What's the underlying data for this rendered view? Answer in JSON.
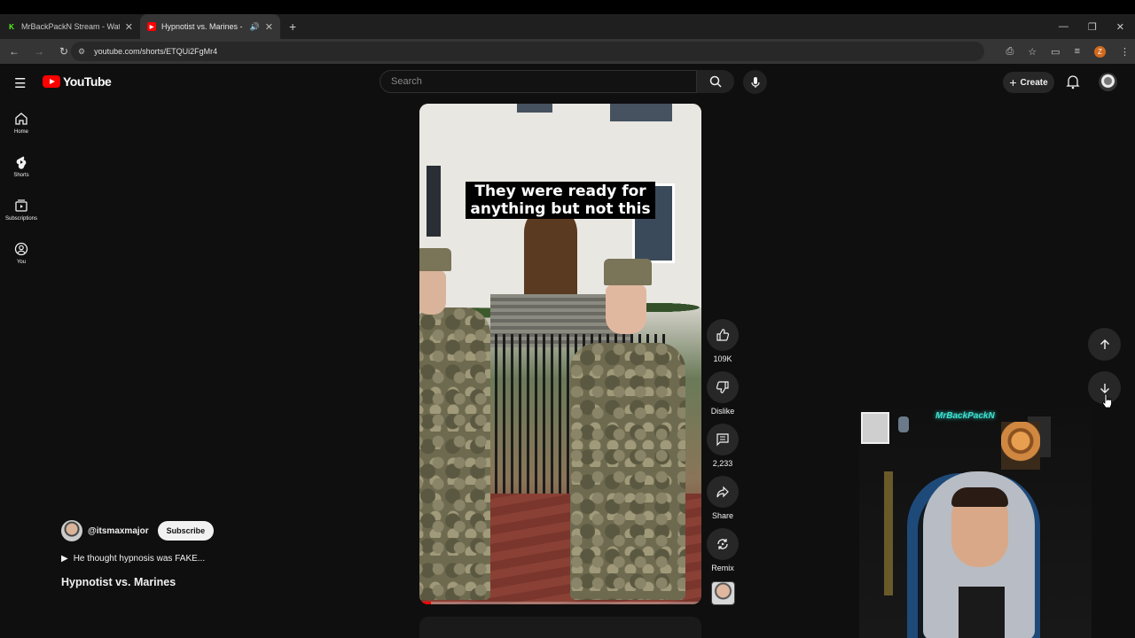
{
  "browser": {
    "tabs": [
      {
        "title": "MrBackPackN Stream - Watch l",
        "favicon": "K",
        "favicon_color": "#53fc18",
        "active": false
      },
      {
        "title": "Hypnotist vs. Marines - You",
        "favicon": "▶",
        "favicon_color": "#ff0000",
        "active": true
      }
    ],
    "url": "youtube.com/shorts/ETQUi2FgMr4",
    "profile_initial": "Z"
  },
  "masthead": {
    "logo_text": "YouTube",
    "search_placeholder": "Search",
    "create_label": "Create"
  },
  "guide": {
    "items": [
      {
        "label": "Home",
        "icon": "home-icon"
      },
      {
        "label": "Shorts",
        "icon": "shorts-icon"
      },
      {
        "label": "Subscriptions",
        "icon": "subscriptions-icon"
      },
      {
        "label": "You",
        "icon": "you-icon"
      }
    ]
  },
  "video": {
    "caption_line1": "They were ready for",
    "caption_line2": "anything but not this",
    "progress": 0.04
  },
  "actions": {
    "like_count": "109K",
    "dislike_label": "Dislike",
    "comment_count": "2,233",
    "share_label": "Share",
    "remix_label": "Remix"
  },
  "meta": {
    "channel_handle": "@itsmaxmajor",
    "subscribe_label": "Subscribe",
    "description": "He thought hypnosis was FAKE...",
    "title": "Hypnotist vs. Marines"
  },
  "webcam": {
    "neon_sign": "MrBackPackN"
  },
  "colors": {
    "brand_red": "#ff0000",
    "background": "#0f0f0f",
    "surface": "#272727"
  }
}
